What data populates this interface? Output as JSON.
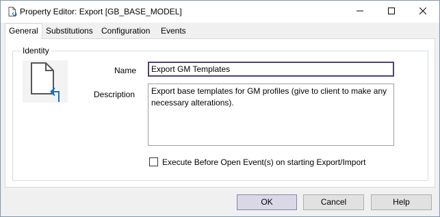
{
  "window": {
    "title": "Property Editor: Export [GB_BASE_MODEL]",
    "title_icon": "document-export-icon",
    "controls": {
      "minimize": "minimize-icon",
      "maximize": "maximize-icon",
      "close": "close-icon"
    }
  },
  "tabs": [
    {
      "label": "General",
      "active": true
    },
    {
      "label": "Substitutions",
      "active": false
    },
    {
      "label": "Configuration",
      "active": false
    },
    {
      "label": "Events",
      "active": false
    }
  ],
  "identity": {
    "group_label": "Identity",
    "icon": "document-export-icon",
    "name_label": "Name",
    "name_value": "Export GM Templates",
    "description_label": "Description",
    "description_value": "Export base templates for GM profiles (give to client to make any necessary alterations).",
    "execute_checkbox_label": "Execute Before Open Event(s) on starting Export/Import",
    "execute_checkbox_checked": false
  },
  "buttons": {
    "ok": "OK",
    "cancel": "Cancel",
    "help": "Help"
  },
  "colors": {
    "accent_focus": "#4e4077",
    "ok_button_bg": "#dad7e7",
    "export_arrow": "#1a73c4"
  }
}
